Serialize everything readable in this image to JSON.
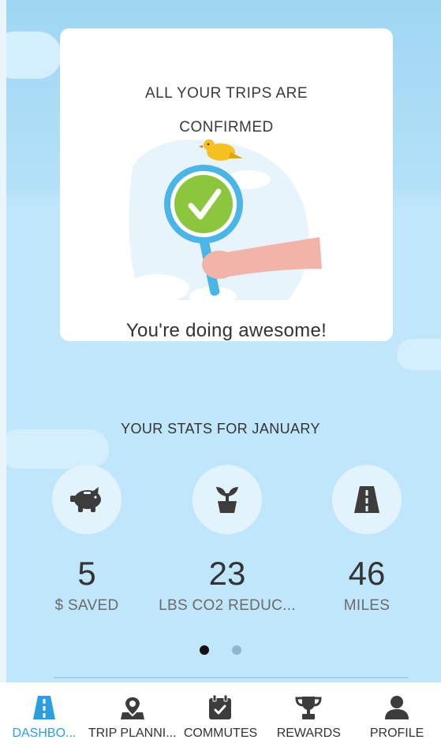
{
  "card": {
    "title_line1": "ALL YOUR TRIPS ARE",
    "title_line2": "CONFIRMED",
    "message": "You're doing awesome!"
  },
  "stats": {
    "title": "YOUR STATS FOR JANUARY",
    "items": [
      {
        "icon": "piggy-bank-icon",
        "value": "5",
        "label": "$ SAVED"
      },
      {
        "icon": "plant-icon",
        "value": "23",
        "label": "LBS CO2 REDUC..."
      },
      {
        "icon": "road-icon",
        "value": "46",
        "label": "MILES"
      }
    ]
  },
  "pager": {
    "count": 2,
    "active_index": 0
  },
  "tabs": [
    {
      "label": "DASHBO...",
      "icon": "road-icon",
      "active": true
    },
    {
      "label": "TRIP PLANNI...",
      "icon": "map-pin-icon",
      "active": false
    },
    {
      "label": "COMMUTES",
      "icon": "calendar-check-icon",
      "active": false
    },
    {
      "label": "REWARDS",
      "icon": "trophy-icon",
      "active": false
    },
    {
      "label": "PROFILE",
      "icon": "person-icon",
      "active": false
    }
  ],
  "colors": {
    "accent": "#2b9fe0",
    "sky": "#bfe6fb",
    "check_green": "#8cc63f",
    "icon_dark": "#3c3c3c"
  }
}
